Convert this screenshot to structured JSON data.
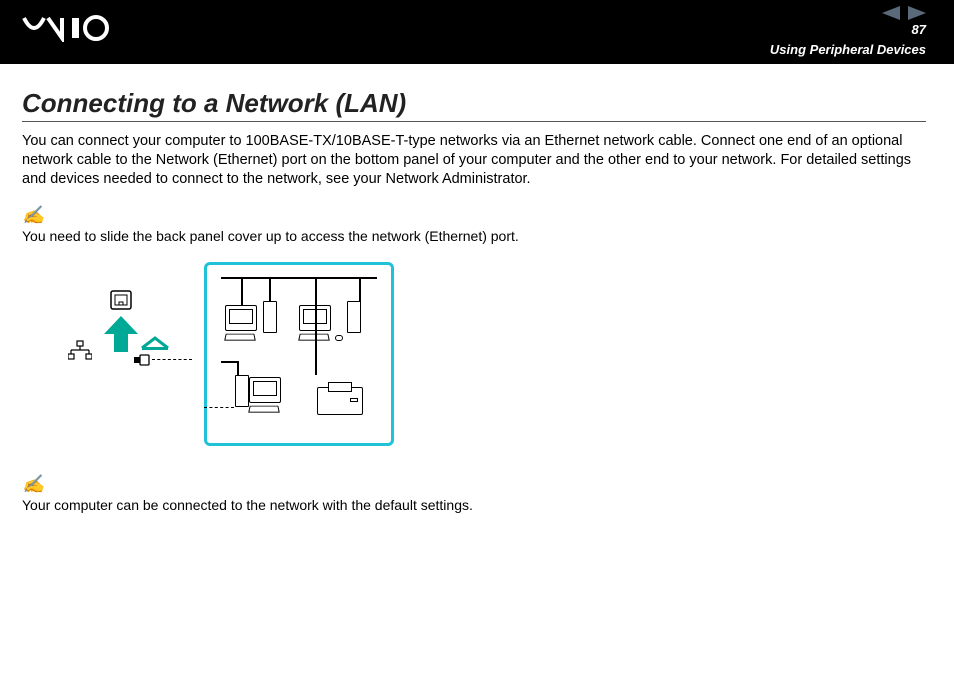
{
  "header": {
    "page_number": "87",
    "section": "Using Peripheral Devices"
  },
  "main": {
    "title": "Connecting to a Network (LAN)",
    "body": "You can connect your computer to 100BASE-TX/10BASE-T-type networks via an Ethernet network cable. Connect one end of an optional network cable to the Network (Ethernet) port on the bottom panel of your computer and the other end to your network. For detailed settings and devices needed to connect to the network, see your Network Administrator.",
    "note1_icon": "✍",
    "note1": "You need to slide the back panel cover up to access the network (Ethernet) port.",
    "note2_icon": "✍",
    "note2": "Your computer can be connected to the network with the default settings."
  }
}
